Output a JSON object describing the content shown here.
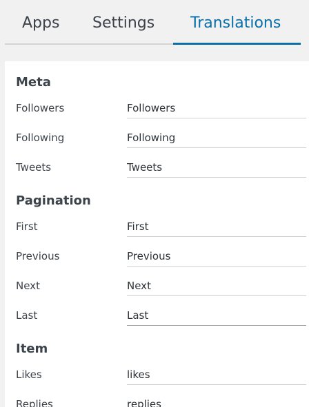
{
  "tabs": [
    {
      "label": "Apps",
      "active": false
    },
    {
      "label": "Settings",
      "active": false
    },
    {
      "label": "Translations",
      "active": true
    }
  ],
  "colors": {
    "accent": "#0a6fa8",
    "background": "#f1f1f1",
    "panel": "#ffffff",
    "text": "#3c434a"
  },
  "sections": {
    "meta": {
      "title": "Meta",
      "rows": [
        {
          "label": "Followers",
          "value": "Followers"
        },
        {
          "label": "Following",
          "value": "Following"
        },
        {
          "label": "Tweets",
          "value": "Tweets"
        }
      ]
    },
    "pagination": {
      "title": "Pagination",
      "rows": [
        {
          "label": "First",
          "value": "First"
        },
        {
          "label": "Previous",
          "value": "Previous"
        },
        {
          "label": "Next",
          "value": "Next"
        },
        {
          "label": "Last",
          "value": "Last"
        }
      ]
    },
    "item": {
      "title": "Item",
      "rows": [
        {
          "label": "Likes",
          "value": "likes"
        },
        {
          "label": "Replies",
          "value": "replies"
        }
      ]
    }
  }
}
